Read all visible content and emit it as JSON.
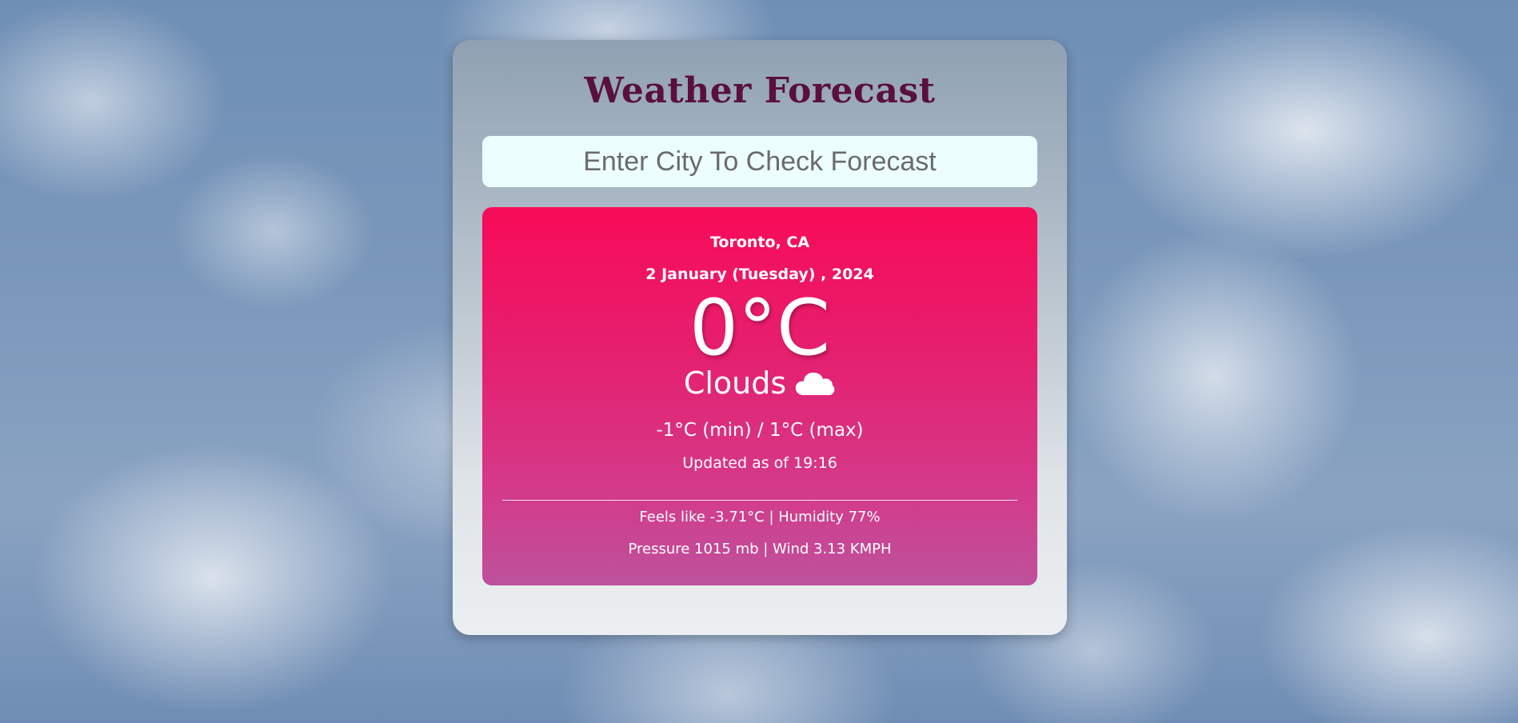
{
  "app": {
    "title": "Weather Forecast"
  },
  "search": {
    "placeholder": "Enter City To Check Forecast",
    "value": ""
  },
  "weather": {
    "location": "Toronto, CA",
    "date": "2 January (Tuesday) , 2024",
    "temperature": "0°C",
    "condition": "Clouds",
    "condition_icon": "cloud-icon",
    "min_max": "-1°C (min) / 1°C (max)",
    "updated": "Updated as of 19:16",
    "feels_humidity": "Feels like -3.71°C | Humidity 77%",
    "pressure_wind": "Pressure 1015 mb | Wind 3.13 KMPH"
  },
  "colors": {
    "title": "#5a0f3e",
    "search_bg": "#edfefe",
    "weather_gradient_top": "#f80b58",
    "weather_gradient_bottom": "#bd529c",
    "text_on_weather": "#ffffff"
  }
}
